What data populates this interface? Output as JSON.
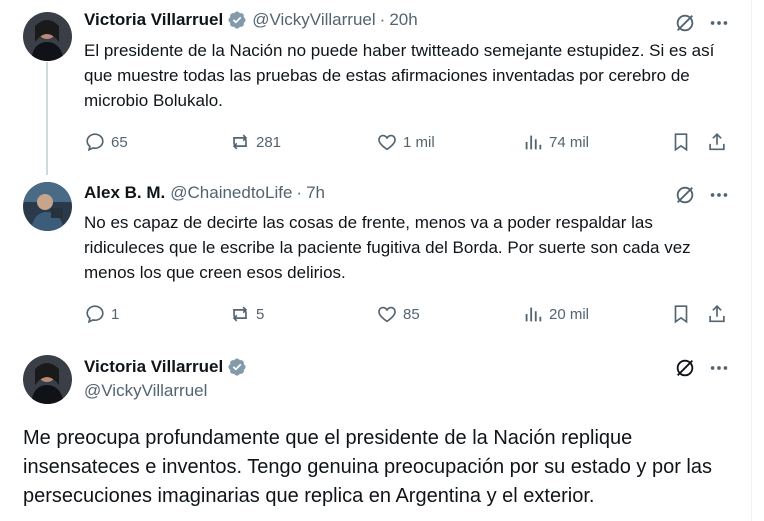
{
  "tweets": [
    {
      "name": "Victoria Villarruel",
      "handle": "@VickyVillarruel",
      "dot": "·",
      "time": "20h",
      "text": "El presidente de la Nación no puede haber twitteado semejante estupidez. Si es así que muestre todas las pruebas de estas afirmaciones inventadas por cerebro de microbio Bolukalo.",
      "replies": "65",
      "reposts": "281",
      "likes": "1 mil",
      "views": "74 mil"
    },
    {
      "name": "Alex B. M.",
      "handle": "@ChainedtoLife",
      "dot": "·",
      "time": "7h",
      "text": "No es capaz de decirte las cosas de frente, menos va a poder respaldar las ridiculeces que le escribe la paciente fugitiva del Borda. Por suerte son cada vez menos los que creen esos delirios.",
      "replies": "1",
      "reposts": "5",
      "likes": "85",
      "views": "20 mil"
    }
  ],
  "main_tweet": {
    "name": "Victoria Villarruel",
    "handle": "@VickyVillarruel",
    "text": "Me preocupa profundamente que el presidente de la Nación replique insensateces e inventos. Tengo genuina preocupación por su estado y por las persecuciones imaginarias que replica en Argentina y el exterior."
  },
  "colors": {
    "verified": "#1d9bf0",
    "secondary_text": "#536471",
    "thread_line": "#cfd9de"
  },
  "icons": [
    "verified-badge-icon",
    "grok-icon",
    "more-icon",
    "reply-icon",
    "repost-icon",
    "like-icon",
    "views-icon",
    "bookmark-icon",
    "share-icon"
  ]
}
